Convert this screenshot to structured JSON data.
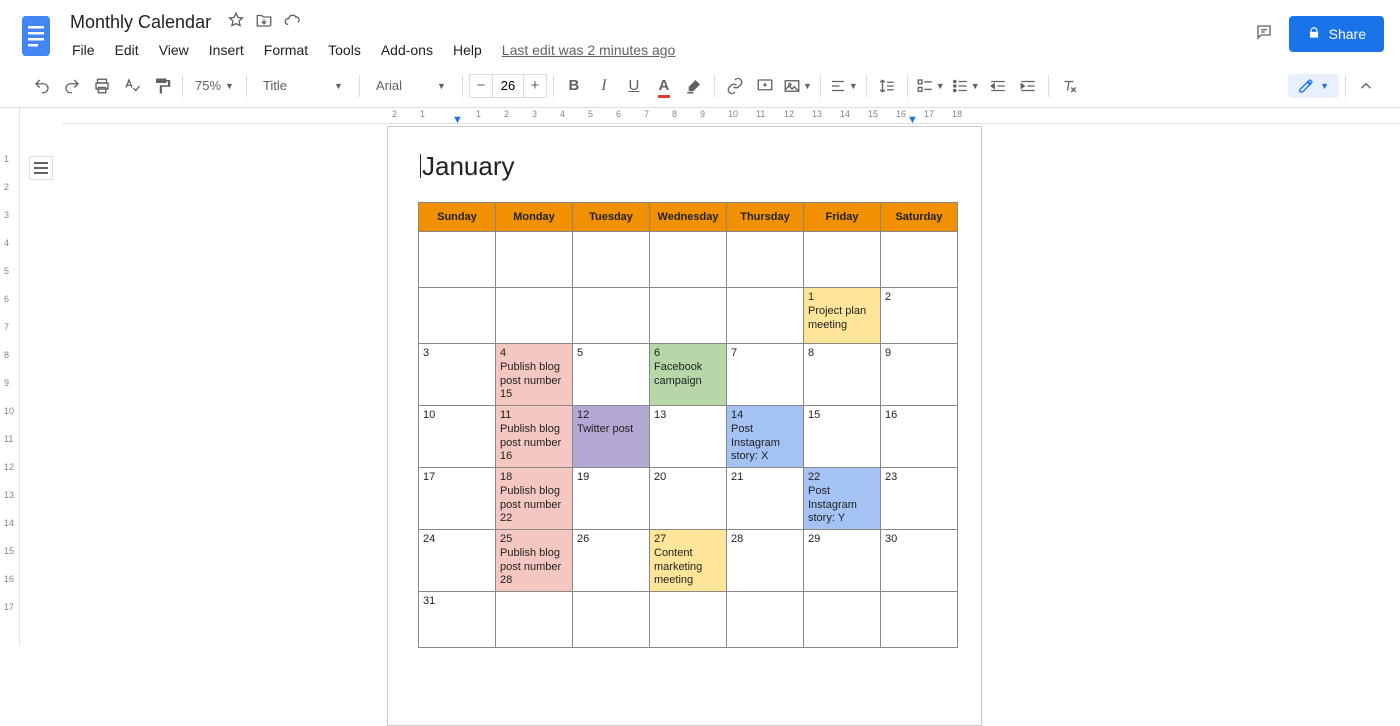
{
  "header": {
    "doc_title": "Monthly Calendar",
    "last_edit": "Last edit was 2 minutes ago",
    "share_label": "Share"
  },
  "menu": [
    "File",
    "Edit",
    "View",
    "Insert",
    "Format",
    "Tools",
    "Add-ons",
    "Help"
  ],
  "toolbar": {
    "zoom": "75%",
    "style": "Title",
    "font": "Arial",
    "size": "26"
  },
  "hruler_ticks": [
    "2",
    "1",
    "",
    "1",
    "2",
    "3",
    "4",
    "5",
    "6",
    "7",
    "8",
    "9",
    "10",
    "11",
    "12",
    "13",
    "14",
    "15",
    "16",
    "17",
    "18"
  ],
  "vruler_ticks": [
    "",
    "1",
    "2",
    "3",
    "4",
    "5",
    "6",
    "7",
    "8",
    "9",
    "10",
    "11",
    "12",
    "13",
    "14",
    "15",
    "16",
    "17"
  ],
  "calendar": {
    "month": "January",
    "days_header": [
      "Sunday",
      "Monday",
      "Tuesday",
      "Wednesday",
      "Thursday",
      "Friday",
      "Saturday"
    ],
    "weeks": [
      [
        {
          "num": "",
          "text": ""
        },
        {
          "num": "",
          "text": ""
        },
        {
          "num": "",
          "text": ""
        },
        {
          "num": "",
          "text": ""
        },
        {
          "num": "",
          "text": ""
        },
        {
          "num": "1",
          "text": "Project plan meeting",
          "color": "yellow"
        },
        {
          "num": "2",
          "text": ""
        }
      ],
      [
        {
          "num": "3",
          "text": ""
        },
        {
          "num": "4",
          "text": "Publish blog post number 15",
          "color": "pink"
        },
        {
          "num": "5",
          "text": ""
        },
        {
          "num": "6",
          "text": "Facebook campaign",
          "color": "green"
        },
        {
          "num": "7",
          "text": ""
        },
        {
          "num": "8",
          "text": ""
        },
        {
          "num": "9",
          "text": ""
        }
      ],
      [
        {
          "num": "10",
          "text": ""
        },
        {
          "num": "11",
          "text": "Publish blog post number 16",
          "color": "pink"
        },
        {
          "num": "12",
          "text": "Twitter post",
          "color": "purple"
        },
        {
          "num": "13",
          "text": ""
        },
        {
          "num": "14",
          "text": "Post Instagram story: X",
          "color": "blue"
        },
        {
          "num": "15",
          "text": ""
        },
        {
          "num": "16",
          "text": ""
        }
      ],
      [
        {
          "num": "17",
          "text": ""
        },
        {
          "num": "18",
          "text": "Publish blog post number 22",
          "color": "pink"
        },
        {
          "num": "19",
          "text": ""
        },
        {
          "num": "20",
          "text": ""
        },
        {
          "num": "21",
          "text": ""
        },
        {
          "num": "22",
          "text": "Post Instagram story: Y",
          "color": "blue"
        },
        {
          "num": "23",
          "text": ""
        }
      ],
      [
        {
          "num": "24",
          "text": ""
        },
        {
          "num": "25",
          "text": "Publish blog post number 28",
          "color": "pink"
        },
        {
          "num": "26",
          "text": ""
        },
        {
          "num": "27",
          "text": "Content marketing meeting",
          "color": "yellow"
        },
        {
          "num": "28",
          "text": ""
        },
        {
          "num": "29",
          "text": ""
        },
        {
          "num": "30",
          "text": ""
        }
      ],
      [
        {
          "num": "31",
          "text": ""
        },
        {
          "num": "",
          "text": ""
        },
        {
          "num": "",
          "text": ""
        },
        {
          "num": "",
          "text": ""
        },
        {
          "num": "",
          "text": ""
        },
        {
          "num": "",
          "text": ""
        },
        {
          "num": "",
          "text": ""
        }
      ]
    ]
  }
}
